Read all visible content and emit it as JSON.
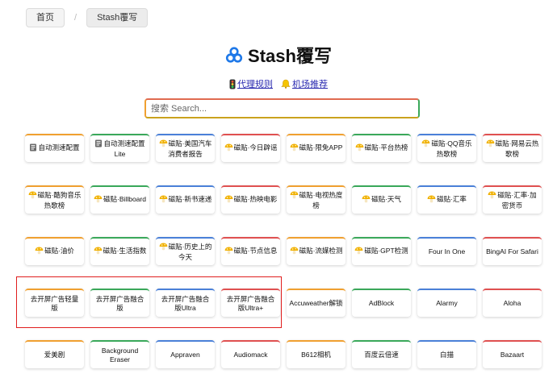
{
  "breadcrumb": {
    "home": "首页",
    "current": "Stash覆写"
  },
  "title": "Stash覆写",
  "links": [
    {
      "label": "代理规则",
      "icon": "traffic-light-icon"
    },
    {
      "label": "机场推荐",
      "icon": "bell-icon"
    }
  ],
  "search": {
    "placeholder": "搜索 Search...",
    "value": ""
  },
  "cards": [
    {
      "label": "自动测速配置",
      "icon": "notebook-icon",
      "color": "orange"
    },
    {
      "label": "自动测速配置Lite",
      "icon": "notebook-icon",
      "color": "green"
    },
    {
      "label": "磁贴·美国汽车消费者报告",
      "icon": "mushroom-icon",
      "color": "blue"
    },
    {
      "label": "磁贴·今日辟谣",
      "icon": "mushroom-icon",
      "color": "red"
    },
    {
      "label": "磁贴·限免APP",
      "icon": "mushroom-icon",
      "color": "orange"
    },
    {
      "label": "磁贴·平台热榜",
      "icon": "mushroom-icon",
      "color": "green"
    },
    {
      "label": "磁贴·QQ音乐热歌榜",
      "icon": "mushroom-icon",
      "color": "blue"
    },
    {
      "label": "磁贴·网易云热歌榜",
      "icon": "mushroom-icon",
      "color": "red"
    },
    {
      "label": "磁贴·酷狗音乐热歌榜",
      "icon": "mushroom-icon",
      "color": "orange"
    },
    {
      "label": "磁贴·Billboard",
      "icon": "mushroom-icon",
      "color": "green"
    },
    {
      "label": "磁贴·新书速递",
      "icon": "mushroom-icon",
      "color": "blue"
    },
    {
      "label": "磁贴·热映电影",
      "icon": "mushroom-icon",
      "color": "red"
    },
    {
      "label": "磁贴·电视热度榜",
      "icon": "mushroom-icon",
      "color": "orange"
    },
    {
      "label": "磁贴·天气",
      "icon": "mushroom-icon",
      "color": "green"
    },
    {
      "label": "磁贴·汇率",
      "icon": "mushroom-icon",
      "color": "blue"
    },
    {
      "label": "磁贴·汇率·加密货币",
      "icon": "mushroom-icon",
      "color": "red"
    },
    {
      "label": "磁贴·油价",
      "icon": "mushroom-icon",
      "color": "orange"
    },
    {
      "label": "磁贴·生活指数",
      "icon": "mushroom-icon",
      "color": "green"
    },
    {
      "label": "磁贴·历史上的今天",
      "icon": "mushroom-icon",
      "color": "blue"
    },
    {
      "label": "磁贴·节点信息",
      "icon": "mushroom-icon",
      "color": "red"
    },
    {
      "label": "磁贴·流媒检测",
      "icon": "mushroom-icon",
      "color": "orange"
    },
    {
      "label": "磁贴·GPT检测",
      "icon": "mushroom-icon",
      "color": "green"
    },
    {
      "label": "Four In One",
      "icon": "",
      "color": "blue"
    },
    {
      "label": "BingAI For Safari",
      "icon": "",
      "color": "red"
    },
    {
      "label": "去开屏广告轻量版",
      "icon": "",
      "color": "orange"
    },
    {
      "label": "去开屏广告融合版",
      "icon": "",
      "color": "green"
    },
    {
      "label": "去开屏广告融合版Ultra",
      "icon": "",
      "color": "blue"
    },
    {
      "label": "去开屏广告融合版Ultra+",
      "icon": "",
      "color": "red"
    },
    {
      "label": "Accuweather解锁",
      "icon": "",
      "color": "orange"
    },
    {
      "label": "AdBlock",
      "icon": "",
      "color": "green"
    },
    {
      "label": "Alarmy",
      "icon": "",
      "color": "blue"
    },
    {
      "label": "Aloha",
      "icon": "",
      "color": "red"
    },
    {
      "label": "爱美剧",
      "icon": "",
      "color": "orange"
    },
    {
      "label": "Background Eraser",
      "icon": "",
      "color": "green"
    },
    {
      "label": "Appraven",
      "icon": "",
      "color": "blue"
    },
    {
      "label": "Audiomack",
      "icon": "",
      "color": "red"
    },
    {
      "label": "B612相机",
      "icon": "",
      "color": "orange"
    },
    {
      "label": "百度云倍速",
      "icon": "",
      "color": "green"
    },
    {
      "label": "白描",
      "icon": "",
      "color": "blue"
    },
    {
      "label": "Bazaart",
      "icon": "",
      "color": "red"
    }
  ]
}
